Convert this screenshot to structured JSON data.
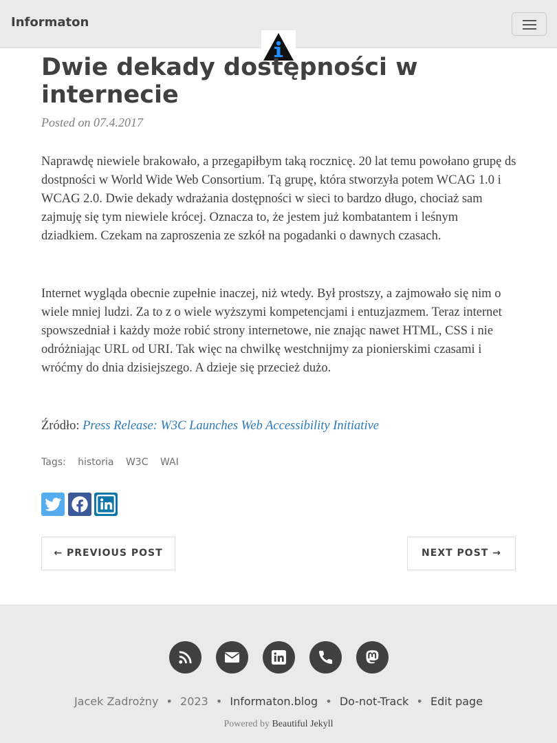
{
  "navbar": {
    "brand": "Informaton",
    "menu_icon": "hamburger-icon",
    "logo_icon": "info-triangle-logo"
  },
  "post": {
    "title": "Dwie dekady dostępności w internecie",
    "meta": "Posted on 07.4.2017",
    "paragraphs": [
      "Naprawdę niewiele brakowało, a przegapiłbym taką rocznicę. 20 lat temu powołano grupę ds dostpności w World Wide Web Consortium. Tą grupę, która stworzyła potem WCAG 1.0 i WCAG 2.0. Dwie dekady wdrażania dostępności w sieci to bardzo długo, chociaż sam zajmuję się tym niewiele krócej. Oznacza to, że jestem już kombatantem i leśnym dziadkiem. Czekam na zaproszenia ze szkół na pogadanki o dawnych czasach.",
      "Internet wygląda obecnie zupełnie inaczej, niż wtedy. Był prostszy, a zajmowało się nim o wiele mniej ludzi. Za to z o wiele wyższymi kompetencjami i entuzjazmem. Teraz internet spowszedniał i każdy może robić strony internetowe, nie znając nawet HTML, CSS i nie odróżniając URL od URI. Tak więc na chwilkę westchnijmy za pionierskimi czasami i wróćmy do dnia dzisiejszego. A dzieje się przecież dużo."
    ],
    "source_label": "Źródło:",
    "source_link": "Press Release: W3C Launches Web Accessibility Initiative"
  },
  "tags": {
    "label": "Tags:",
    "items": [
      "historia",
      "W3C",
      "WAI"
    ]
  },
  "share": {
    "twitter_icon": "twitter-icon",
    "facebook_icon": "facebook-icon",
    "linkedin_icon": "linkedin-icon"
  },
  "pager": {
    "previous": "← PREVIOUS POST",
    "next": "NEXT POST →"
  },
  "footer": {
    "social_icons": [
      "rss-icon",
      "envelope-icon",
      "linkedin-icon",
      "phone-icon",
      "mastodon-icon"
    ],
    "author": "Jacek Zadrożny",
    "separator": "•",
    "year": "2023",
    "site": "Informaton.blog",
    "dnt": "Do-not-Track",
    "edit": "Edit page",
    "powered_prefix": "Powered by",
    "powered_link": "Beautiful Jekyll"
  },
  "colors": {
    "navbar_bg": "#eaeaea",
    "text": "#404040",
    "link": "#2a7ab8",
    "twitter": "#55acee",
    "facebook": "#3b5998",
    "linkedin": "#0e76a8"
  }
}
